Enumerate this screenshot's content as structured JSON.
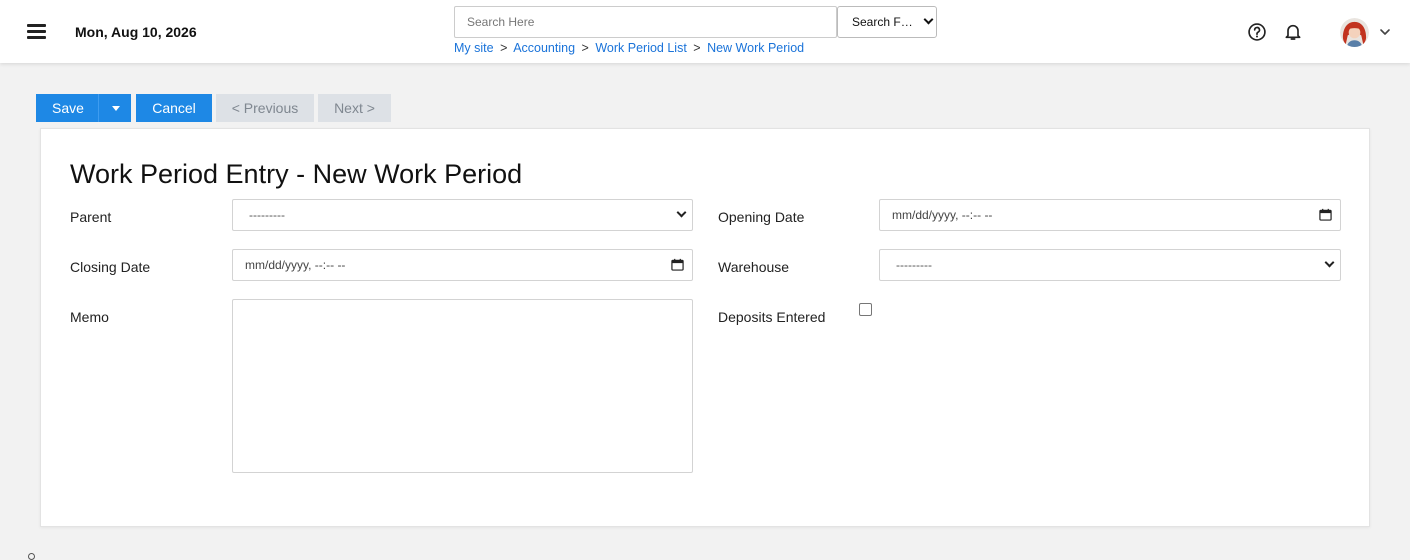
{
  "header": {
    "date": "Mon, Aug 10, 2026",
    "search": {
      "placeholder": "Search Here",
      "value": ""
    },
    "search_for": {
      "selected": "Search For..."
    },
    "breadcrumb": {
      "items": [
        "My site",
        "Accounting",
        "Work Period List",
        "New Work Period"
      ],
      "separator": ">"
    },
    "icons": {
      "menu": "hamburger-menu-icon",
      "help": "help-circle-icon",
      "notifications": "bell-icon",
      "user_menu": "chevron-down-icon"
    }
  },
  "toolbar": {
    "save_label": "Save",
    "cancel_label": "Cancel",
    "previous_label": "< Previous",
    "next_label": "Next >"
  },
  "form": {
    "title": "Work Period Entry - New Work Period",
    "fields": {
      "parent": {
        "label": "Parent",
        "value": "---------"
      },
      "opening_date": {
        "label": "Opening Date",
        "value": "mm/dd/yyyy, --:-- --"
      },
      "closing_date": {
        "label": "Closing Date",
        "value": "mm/dd/yyyy, --:-- --"
      },
      "warehouse": {
        "label": "Warehouse",
        "value": "---------"
      },
      "memo": {
        "label": "Memo",
        "value": ""
      },
      "deposits_entered": {
        "label": "Deposits Entered",
        "checked": false
      }
    }
  },
  "colors": {
    "primary": "#1e88e5",
    "link": "#1a73d9",
    "disabled_bg": "#dde1e6",
    "disabled_text": "#7f8790",
    "page_bg": "#f2f2f2"
  }
}
